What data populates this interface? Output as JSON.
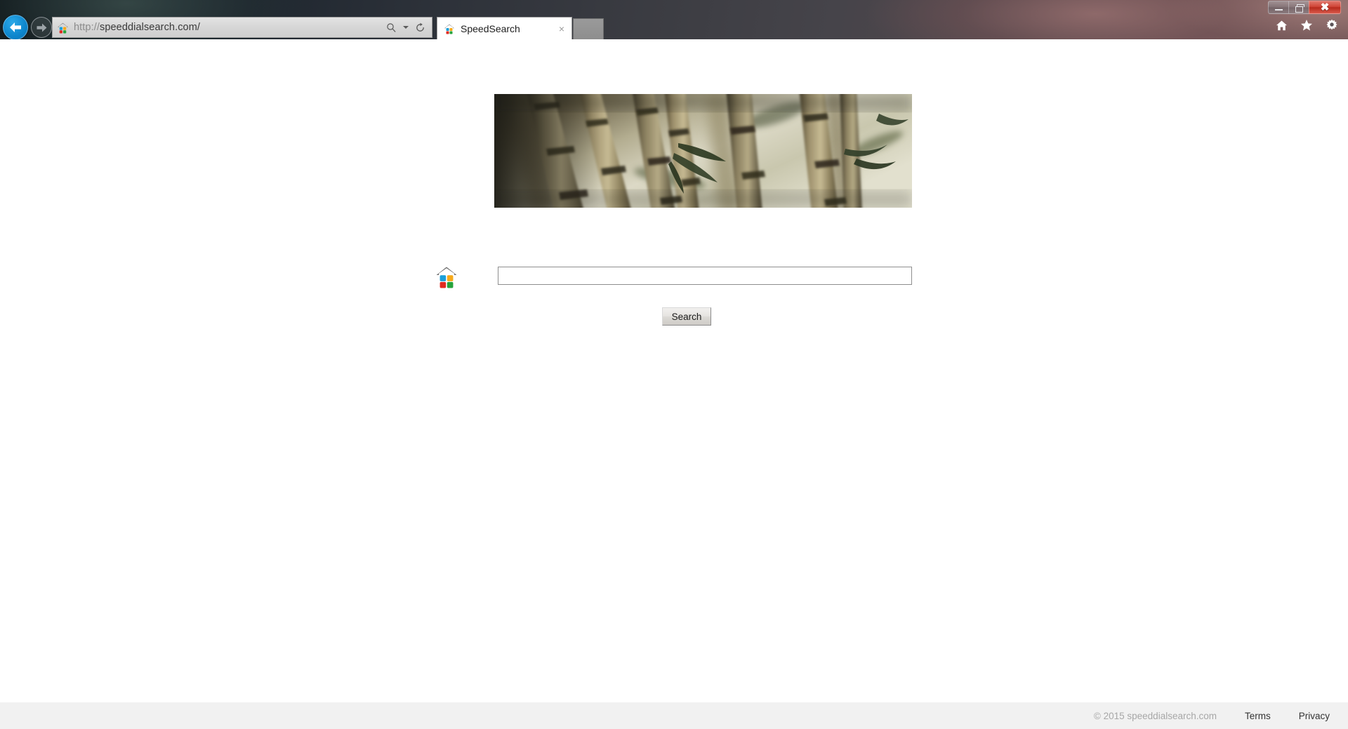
{
  "browser": {
    "window_controls": {
      "minimize_label": "Minimize",
      "restore_label": "Restore",
      "close_label": "✖"
    },
    "nav": {
      "back_label": "back-arrow",
      "forward_label": "forward-arrow"
    },
    "address_bar": {
      "scheme": "http://",
      "host_path": "speeddialsearch.com/",
      "favicon": "speeddial-house-icon",
      "search_icon": "search-icon",
      "refresh_icon": "refresh-icon"
    },
    "tabs": [
      {
        "title": "SpeedSearch",
        "favicon": "speeddial-house-icon",
        "close_label": "×",
        "active": true
      }
    ],
    "new_tab_label": "",
    "toolbar_icons": [
      {
        "name": "home-icon",
        "glyph": "⌂"
      },
      {
        "name": "favorites-star-icon",
        "glyph": "★"
      },
      {
        "name": "settings-gear-icon",
        "glyph": "⚙"
      }
    ]
  },
  "page": {
    "banner": {
      "alt": "bamboo-forest-banner"
    },
    "logo": {
      "name": "speeddial-house-logo",
      "colors": {
        "roof": "#6e6e6e",
        "top_left": "#1a9fd9",
        "top_right": "#f6a91a",
        "bottom_left": "#e02b20",
        "bottom_right": "#26a33b"
      }
    },
    "search": {
      "value": "",
      "placeholder": ""
    },
    "search_button": {
      "label": "Search"
    },
    "footer": {
      "copyright": "© 2015 speeddialsearch.com",
      "links": [
        {
          "label": "Terms"
        },
        {
          "label": "Privacy"
        }
      ]
    }
  }
}
